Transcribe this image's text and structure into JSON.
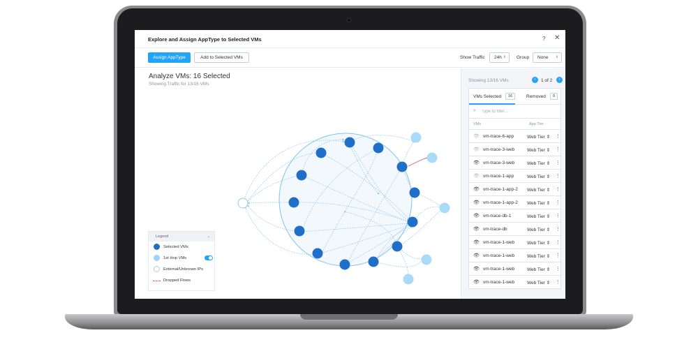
{
  "dialog": {
    "title": "Explore and Assign AppType to Selected VMs",
    "help": "?",
    "close": "✕"
  },
  "toolbar": {
    "assign_label": "Assign AppType",
    "add_label": "Add to Selected VMs",
    "show_traffic_label": "Show Traffic",
    "traffic_value": "24h",
    "group_label": "Group",
    "group_value": "None"
  },
  "graph": {
    "title": "Analyze VMs: 16 Selected",
    "subtitle": "Showing Traffic for 13/16 VMs"
  },
  "legend": {
    "header": "Legend",
    "selected": "Selected VMs",
    "hop": "1st Hop VMs",
    "external": "External/Unknown IPs",
    "dropped": "Dropped Flows",
    "colors": {
      "selected": "#1f6fc9",
      "hop": "#9fd3f5",
      "external": "#ffffff",
      "dropped": "#e15b64"
    }
  },
  "panel": {
    "showing": "Showing 13/16 VMs",
    "page": "1 of 2",
    "tab_selected": "VMs Selected",
    "tab_selected_count": "16",
    "tab_removed": "Removed",
    "tab_removed_count": "0",
    "filter_placeholder": "Type to filter...",
    "col_vms": "VMs",
    "col_tier": "App Tier",
    "rows": [
      {
        "name": "vm-trace-6-app",
        "tier": "Web Tier",
        "visible": false
      },
      {
        "name": "vm-trace-3-web",
        "tier": "Web Tier",
        "visible": false
      },
      {
        "name": "vm-trace-3-web",
        "tier": "Web Tier",
        "visible": true
      },
      {
        "name": "vm-trace-1-app",
        "tier": "Web Tier",
        "visible": false
      },
      {
        "name": "vm-trace-1-app-2",
        "tier": "Web Tier",
        "visible": true
      },
      {
        "name": "vm-trace-1-app-2",
        "tier": "Web Tier",
        "visible": true
      },
      {
        "name": "vm-trace-db-1",
        "tier": "Web Tier",
        "visible": true
      },
      {
        "name": "vm-trace-db",
        "tier": "Web Tier",
        "visible": true
      },
      {
        "name": "vm-trace-1-web",
        "tier": "Web Tier",
        "visible": true
      },
      {
        "name": "vm-trace-1-web",
        "tier": "Web Tier",
        "visible": true
      },
      {
        "name": "vm-trace-1-web",
        "tier": "Web Tier",
        "visible": true
      },
      {
        "name": "vm-trace-1-web",
        "tier": "Web Tier",
        "visible": true
      }
    ]
  }
}
